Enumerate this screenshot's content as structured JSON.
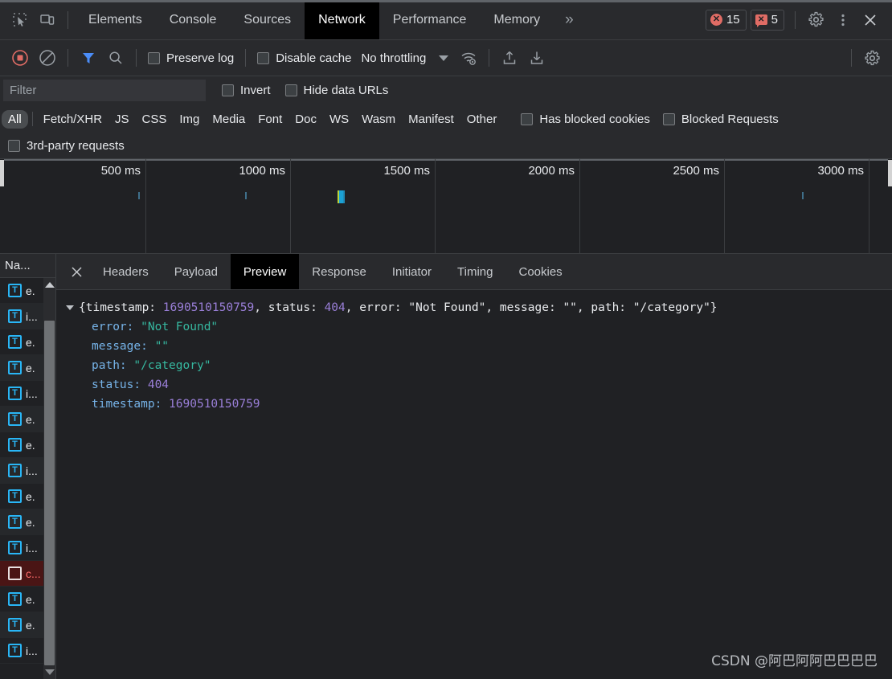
{
  "topbar": {
    "inspect_icon": "inspect-cursor-icon",
    "device_icon": "device-toolbar-icon",
    "tabs": [
      {
        "label": "Elements",
        "active": false
      },
      {
        "label": "Console",
        "active": false
      },
      {
        "label": "Sources",
        "active": false
      },
      {
        "label": "Network",
        "active": true
      },
      {
        "label": "Performance",
        "active": false
      },
      {
        "label": "Memory",
        "active": false
      }
    ],
    "more_label": "»",
    "error_count": "15",
    "warning_count": "5",
    "settings_icon": "gear-icon",
    "menu_icon": "kebab-menu-icon",
    "close_icon": "close-icon"
  },
  "toolbar": {
    "record_icon": "record-stop-icon",
    "clear_icon": "clear-icon",
    "filter_icon": "filter-funnel-icon",
    "search_icon": "search-icon",
    "preserve_log_label": "Preserve log",
    "preserve_log_checked": false,
    "disable_cache_label": "Disable cache",
    "disable_cache_checked": false,
    "throttling_value": "No throttling",
    "network_conditions_icon": "wifi-settings-icon",
    "import_icon": "import-har-icon",
    "export_icon": "export-har-icon",
    "settings_icon": "network-settings-gear-icon"
  },
  "filterbar": {
    "filter_value": "",
    "filter_placeholder": "Filter",
    "invert_label": "Invert",
    "invert_checked": false,
    "hide_data_urls_label": "Hide data URLs",
    "hide_data_urls_checked": false
  },
  "types": {
    "items": [
      {
        "label": "All",
        "active": true
      },
      {
        "label": "Fetch/XHR",
        "active": false
      },
      {
        "label": "JS",
        "active": false
      },
      {
        "label": "CSS",
        "active": false
      },
      {
        "label": "Img",
        "active": false
      },
      {
        "label": "Media",
        "active": false
      },
      {
        "label": "Font",
        "active": false
      },
      {
        "label": "Doc",
        "active": false
      },
      {
        "label": "WS",
        "active": false
      },
      {
        "label": "Wasm",
        "active": false
      },
      {
        "label": "Manifest",
        "active": false
      },
      {
        "label": "Other",
        "active": false
      }
    ],
    "has_blocked_cookies_label": "Has blocked cookies",
    "has_blocked_cookies_checked": false,
    "blocked_requests_label": "Blocked Requests",
    "blocked_requests_checked": false,
    "third_party_label": "3rd-party requests",
    "third_party_checked": false
  },
  "overview": {
    "ticks": [
      "500 ms",
      "1000 ms",
      "1500 ms",
      "2000 ms",
      "2500 ms",
      "3000 ms"
    ],
    "events": [
      {
        "time_ms": 480,
        "type": "tick"
      },
      {
        "time_ms": 845,
        "type": "tick"
      },
      {
        "time_ms": 1435,
        "type": "bar"
      },
      {
        "time_ms": 2790,
        "type": "tick"
      }
    ],
    "range_ms": [
      0,
      3300
    ]
  },
  "requestlist": {
    "header": "Na...",
    "rows": [
      {
        "icon": "doc-icon",
        "name": "e."
      },
      {
        "icon": "doc-icon",
        "name": "i..."
      },
      {
        "icon": "doc-icon",
        "name": "e."
      },
      {
        "icon": "doc-icon",
        "name": "e."
      },
      {
        "icon": "doc-icon",
        "name": "i..."
      },
      {
        "icon": "doc-icon",
        "name": "e."
      },
      {
        "icon": "doc-icon",
        "name": "e."
      },
      {
        "icon": "doc-icon",
        "name": "i..."
      },
      {
        "icon": "doc-icon",
        "name": "e."
      },
      {
        "icon": "doc-icon",
        "name": "e."
      },
      {
        "icon": "doc-icon",
        "name": "i..."
      },
      {
        "icon": "error-doc-icon",
        "name": "c...",
        "selected": true
      },
      {
        "icon": "doc-icon",
        "name": "e."
      },
      {
        "icon": "doc-icon",
        "name": "e."
      },
      {
        "icon": "doc-icon",
        "name": "i..."
      }
    ]
  },
  "details": {
    "close_icon": "close-icon",
    "tabs": [
      {
        "label": "Headers",
        "active": false
      },
      {
        "label": "Payload",
        "active": false
      },
      {
        "label": "Preview",
        "active": true
      },
      {
        "label": "Response",
        "active": false
      },
      {
        "label": "Initiator",
        "active": false
      },
      {
        "label": "Timing",
        "active": false
      },
      {
        "label": "Cookies",
        "active": false
      }
    ]
  },
  "preview": {
    "summary": {
      "open_brace": "{",
      "k_timestamp": "timestamp: ",
      "v_timestamp": "1690510150759",
      "sep1": ", ",
      "k_status": "status: ",
      "v_status": "404",
      "sep2": ", ",
      "k_error": "error: ",
      "v_error": "\"Not Found\"",
      "sep3": ", ",
      "k_message": "message: ",
      "v_message": "\"\"",
      "sep4": ", ",
      "k_path": "path: ",
      "v_path": "\"/category\"",
      "close_brace": "}"
    },
    "fields": [
      {
        "key": "error:",
        "value": "\"Not Found\"",
        "kind": "string"
      },
      {
        "key": "message:",
        "value": "\"\"",
        "kind": "string"
      },
      {
        "key": "path:",
        "value": "\"/category\"",
        "kind": "string"
      },
      {
        "key": "status:",
        "value": "404",
        "kind": "number"
      },
      {
        "key": "timestamp:",
        "value": "1690510150759",
        "kind": "number"
      }
    ]
  },
  "watermark": "CSDN @阿巴阿阿巴巴巴巴"
}
